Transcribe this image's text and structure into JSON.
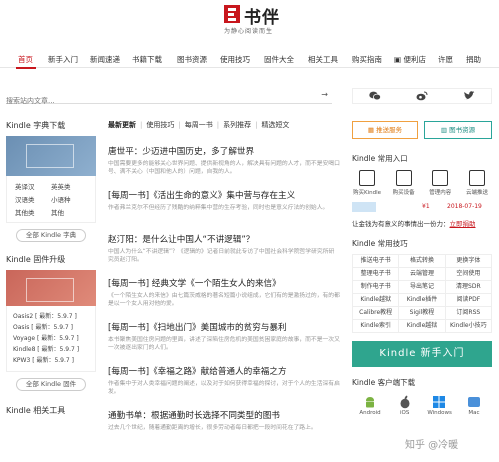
{
  "header": {
    "logo_text": "书伴",
    "slogan": "为静心阅读而生"
  },
  "nav": {
    "items": [
      "首页",
      "新手入门",
      "新闻速递",
      "书籍下载",
      "图书资源",
      "使用技巧",
      "固件大全",
      "相关工具",
      "购买指南",
      "便利店",
      "许愿",
      "捐助"
    ],
    "active_index": 0
  },
  "search": {
    "placeholder": "搜索站内文章...",
    "submit_icon": "arrow-right"
  },
  "left": {
    "dict_title": "Kindle 字典下载",
    "dict_links": [
      "英译汉",
      "英英类",
      "汉语类",
      "小语种",
      "其他类",
      "其他"
    ],
    "dict_button": "全部 Kindle 字典",
    "firmware_title": "Kindle 固件升级",
    "firmware_list": [
      "Oasis2 [ 最新：5.9.7 ]",
      "Oasis [ 最新：5.9.7 ]",
      "Voyage [ 最新：5.9.7 ]",
      "Kindle8 [ 最新：5.9.7 ]",
      "KPW3 [ 最新：5.9.7 ]"
    ],
    "firmware_button": "全部 Kindle 固件",
    "tools_title": "Kindle 相关工具"
  },
  "center": {
    "tabs": [
      "最新更新",
      "使用技巧",
      "每周一书",
      "系列推荐",
      "精选短文"
    ],
    "articles": [
      {
        "title": "唐世平：少迈进中国历史，多了解世界",
        "excerpt": "中国需要更多的能够关心世界问题、提供新视角的人，解决具有问题的人才，而不是安喝口号、满不关心（中国和他人的）问题，自我的人。"
      },
      {
        "title": "[每周一书]《活出生命的意义》集中营与存在主义",
        "excerpt": "作者弗兰克尔不但经历了残酷的纳粹集中营的生存考验，同时也是意义疗法的创始人。"
      },
      {
        "title": "赵汀阳：是什么让中国人“不讲逻辑”？",
        "excerpt": "中国人为什么“不讲逻辑”？《逻辑的》记者日前就此专访了中国社会科学院哲学研究所研究员赵汀阳。"
      },
      {
        "title": "[每周一书] 经典文学《一个陌生女人的来信》",
        "excerpt": "《一个陌生女人的来信》由七篇茨威格的著名短篇小说组成，它们有的是激扬过的，有的都是以一个女人用对他的爱。"
      },
      {
        "title": "[每周一书]《扫地出门》美国城市的贫穷与暴利",
        "excerpt": "本书聚焦美国住房问题的里面，讲述了深陷住房危机的美国贫困家庭的故事，而不是一次又一次被逐出家门的人们。"
      },
      {
        "title": "[每周一书]《幸福之路》献给普通人的幸福之方",
        "excerpt": "作者集中于对人类幸福问题的阐述，以及对于如何获得幸福的探讨，对于个人的生活深有启发。"
      },
      {
        "title": "通勤书单：根据通勤时长选择不同类型的图书",
        "excerpt": "过去几个世纪，随着通勤距离的增长，很多劳动者每日都把一段时间花在了路上。"
      }
    ]
  },
  "right": {
    "social_icons": [
      "wechat-icon",
      "weibo-icon",
      "twitter-icon"
    ],
    "push_service": "推送服务",
    "book_resources": "图书资源",
    "entry_title": "Kindle 常用入口",
    "entries": [
      "购买Kindle",
      "购买设备",
      "管理内容",
      "云端推送"
    ],
    "price": "¥1",
    "date": "2018-07-19",
    "lottery_text": "让金钱为有意义的事情出一份力：",
    "lottery_link": "立即捐助",
    "tips_title": "Kindle 常用技巧",
    "tips": [
      "推送电子书",
      "格式转换",
      "更换字体",
      "整理电子书",
      "云端管理",
      "空间使用",
      "制作电子书",
      "导出笔记",
      "清理SDR",
      "Kindle越狱",
      "Kindle插件",
      "阅读PDF",
      "Calibre教程",
      "Sigil教程",
      "订阅RSS",
      "Kindle索引",
      "Kindle越狱",
      "Kindle小技巧"
    ],
    "kindle_newbie": "Kindle 新手入门",
    "client_title": "Kindle 客户端下载",
    "clients": [
      "Android",
      "iOS",
      "Windows",
      "Mac"
    ]
  },
  "watermark": "知乎 @冷暖"
}
